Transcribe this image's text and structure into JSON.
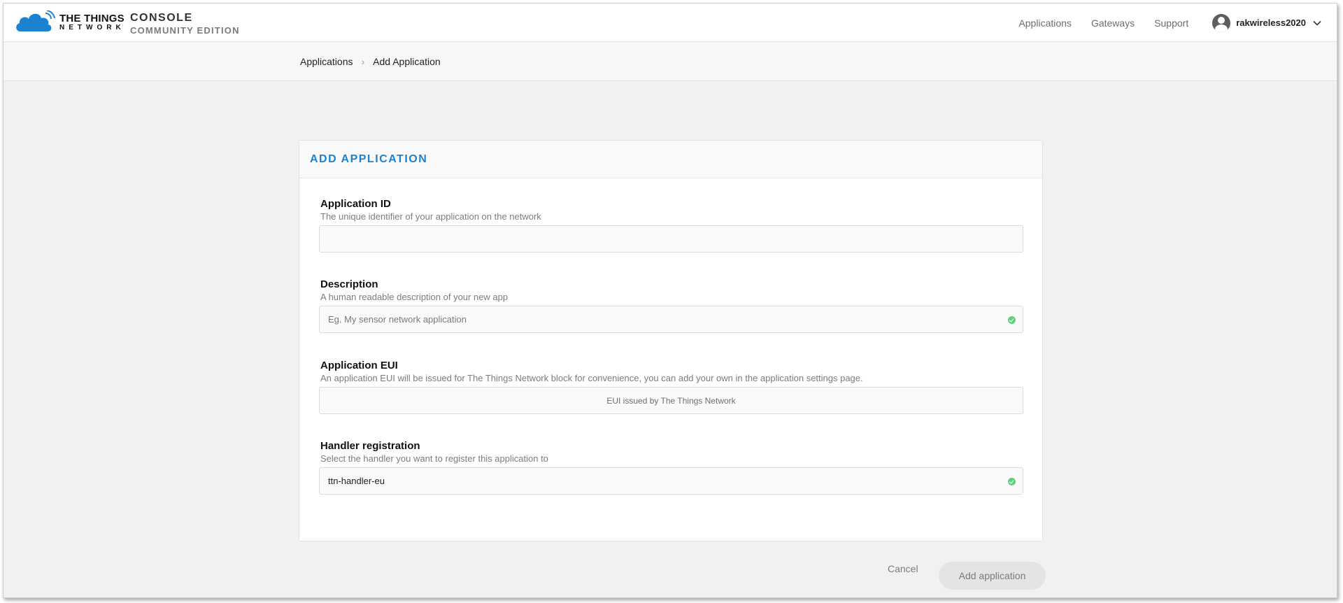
{
  "brand": {
    "logo_line1": "THE THINGS",
    "logo_line2": "NETWORK",
    "console_title": "CONSOLE",
    "console_subtitle": "COMMUNITY EDITION",
    "accent_color": "#1b82d1"
  },
  "nav": {
    "links": [
      "Applications",
      "Gateways",
      "Support"
    ],
    "username": "rakwireless2020"
  },
  "breadcrumb": {
    "items": [
      "Applications",
      "Add Application"
    ]
  },
  "form": {
    "title": "ADD APPLICATION",
    "fields": [
      {
        "label": "Application ID",
        "description": "The unique identifier of your application on the network",
        "value": "",
        "placeholder": ""
      },
      {
        "label": "Description",
        "description": "A human readable description of your new app",
        "value": "",
        "placeholder": "Eg. My sensor network application"
      },
      {
        "label": "Application EUI",
        "description": "An application EUI will be issued for The Things Network block for convenience, you can add your own in the application settings page.",
        "value": "EUI issued by The Things Network"
      },
      {
        "label": "Handler registration",
        "description": "Select the handler you want to register this application to",
        "value": "ttn-handler-eu"
      }
    ]
  },
  "actions": {
    "cancel_label": "Cancel",
    "submit_label": "Add application"
  }
}
